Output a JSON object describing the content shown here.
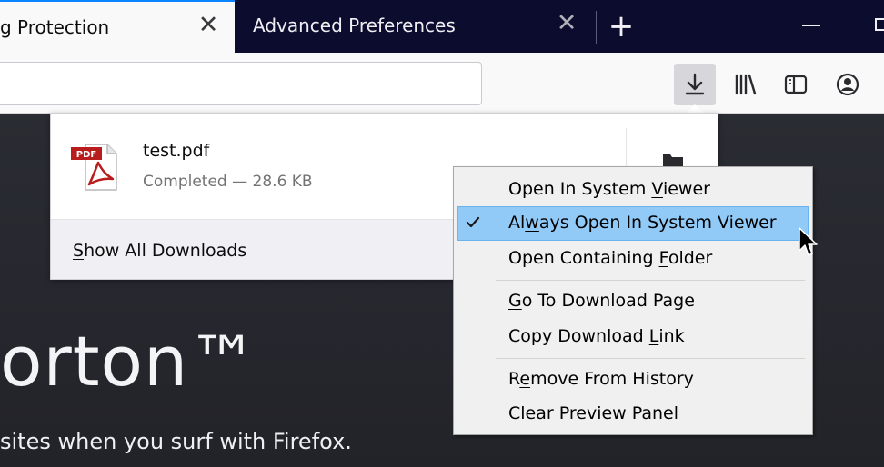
{
  "tabs": [
    {
      "title": "g Protection",
      "active": true
    },
    {
      "title": "Advanced Preferences",
      "active": false
    }
  ],
  "toolbar": {
    "icons": [
      "download-icon",
      "library-icon",
      "sidebar-icon",
      "account-icon"
    ]
  },
  "downloads_panel": {
    "file_name": "test.pdf",
    "status": "Completed — 28.6 KB",
    "show_all": {
      "pre": "",
      "key": "S",
      "post": "how All Downloads"
    }
  },
  "context_menu": {
    "items": [
      {
        "pre": "Open In System ",
        "key": "V",
        "post": "iewer",
        "checked": false
      },
      {
        "pre": "Al",
        "key": "w",
        "post": "ays Open In System Viewer",
        "checked": true,
        "highlighted": true
      },
      {
        "pre": "Open Containing ",
        "key": "F",
        "post": "older",
        "checked": false
      },
      {
        "pre": "",
        "key": "G",
        "post": "o To Download Page",
        "checked": false
      },
      {
        "pre": "Copy Download ",
        "key": "L",
        "post": "ink",
        "checked": false
      },
      {
        "pre": "R",
        "key": "e",
        "post": "move From History",
        "checked": false
      },
      {
        "pre": "Cle",
        "key": "a",
        "post": "r Preview Panel",
        "checked": false
      }
    ]
  },
  "page": {
    "hero_title": "orton™",
    "hero_subtitle": "sites when you surf with Firefox."
  },
  "colors": {
    "tab_strip": "#0c0c2e",
    "active_tab_accent": "#0a84ff",
    "menu_highlight": "#91c9f7"
  }
}
